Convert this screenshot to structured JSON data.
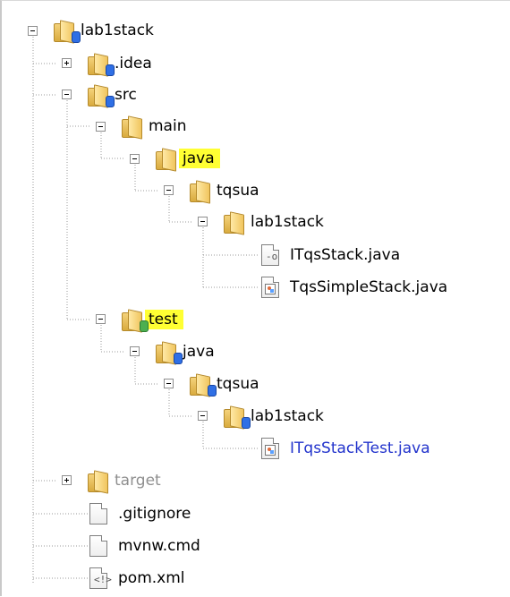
{
  "tree": {
    "items": [
      {
        "label": "lab1stack"
      },
      {
        "label": ".idea"
      },
      {
        "label": "src"
      },
      {
        "label": "main"
      },
      {
        "label": "java"
      },
      {
        "label": "tqsua"
      },
      {
        "label": "lab1stack"
      },
      {
        "label": "ITqsStack.java"
      },
      {
        "label": "TqsSimpleStack.java"
      },
      {
        "label": "test"
      },
      {
        "label": "java"
      },
      {
        "label": "tqsua"
      },
      {
        "label": "lab1stack"
      },
      {
        "label": "ITqsStackTest.java"
      },
      {
        "label": "target"
      },
      {
        "label": ".gitignore"
      },
      {
        "label": "mvnw.cmd"
      },
      {
        "label": "pom.xml"
      }
    ]
  },
  "colors": {
    "highlight": "#ffff33",
    "link": "#2233cc",
    "muted": "#8f8f8f"
  }
}
